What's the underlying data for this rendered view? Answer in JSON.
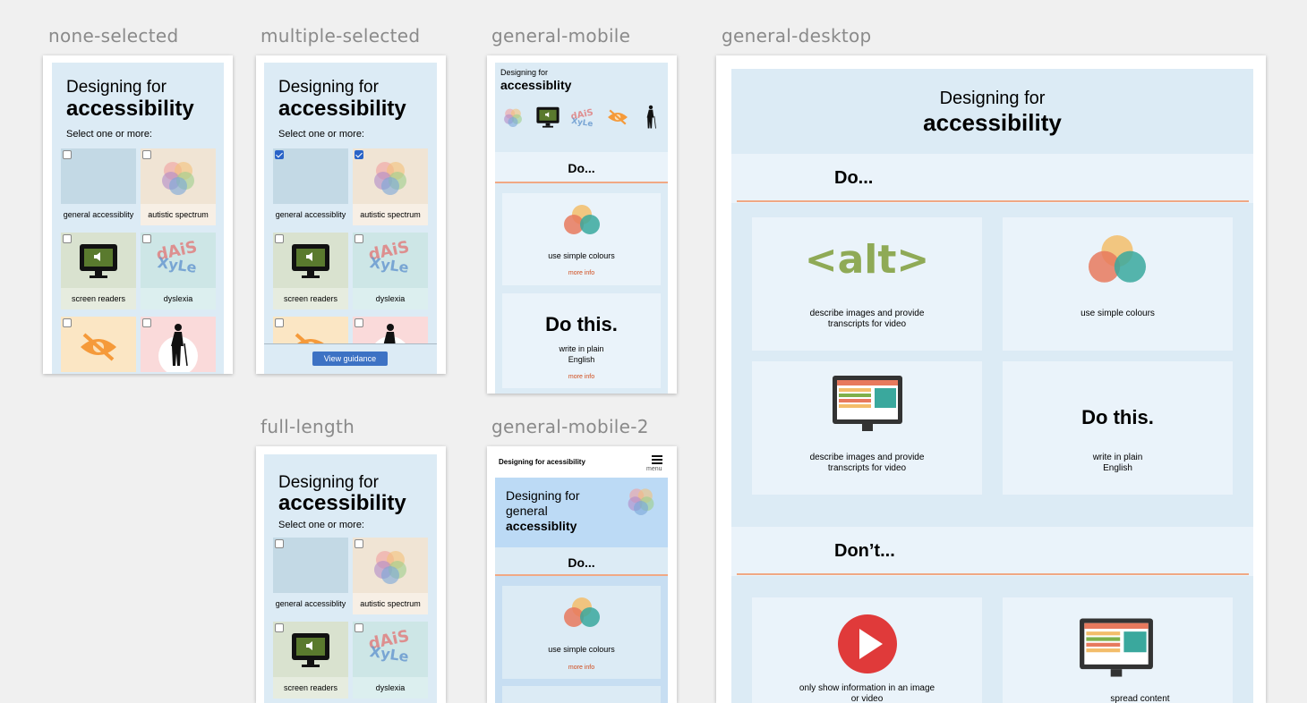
{
  "frames": {
    "none_selected": "none-selected",
    "multiple_selected": "multiple-selected",
    "general_mobile": "general-mobile",
    "general_desktop": "general-desktop",
    "full_length": "full-length",
    "general_mobile_2": "general-mobile-2"
  },
  "hero": {
    "line1": "Designing for",
    "line2": "accessibility"
  },
  "hero_mobile": {
    "line1": "Designing for",
    "line2": "accessiblity"
  },
  "hero_mobile2": {
    "line1": "Designing for",
    "line2": "general",
    "line3": "accessiblity"
  },
  "select_prompt": "Select one or more:",
  "tiles": {
    "general": "general accessiblity",
    "autistic": "autistic spectrum",
    "screen": "screen readers",
    "dyslexia": "dyslexia"
  },
  "view_guidance": "View guidance",
  "do_heading": "Do...",
  "dont_heading": "Don’t...",
  "mobile_cards": {
    "colours": "use simple colours",
    "more_info": "more info",
    "do_this": "Do this.",
    "plain": "write in plain English"
  },
  "mobile2": {
    "nav_title": "Designing for acessibility",
    "menu": "menu"
  },
  "desktop": {
    "alt_text": "<alt>",
    "describe": "describe images and provide transcripts for video",
    "colours": "use simple colours",
    "describe2": "describe images and provide transcripts for video",
    "do_this": "Do this.",
    "plain": "write in plain English",
    "only_show": "only show information in an image or video",
    "spread": "spread content"
  },
  "colors": {
    "accent_orange": "#f0a884",
    "hero_blue": "#dcebf5",
    "button_blue": "#3d72c4"
  }
}
